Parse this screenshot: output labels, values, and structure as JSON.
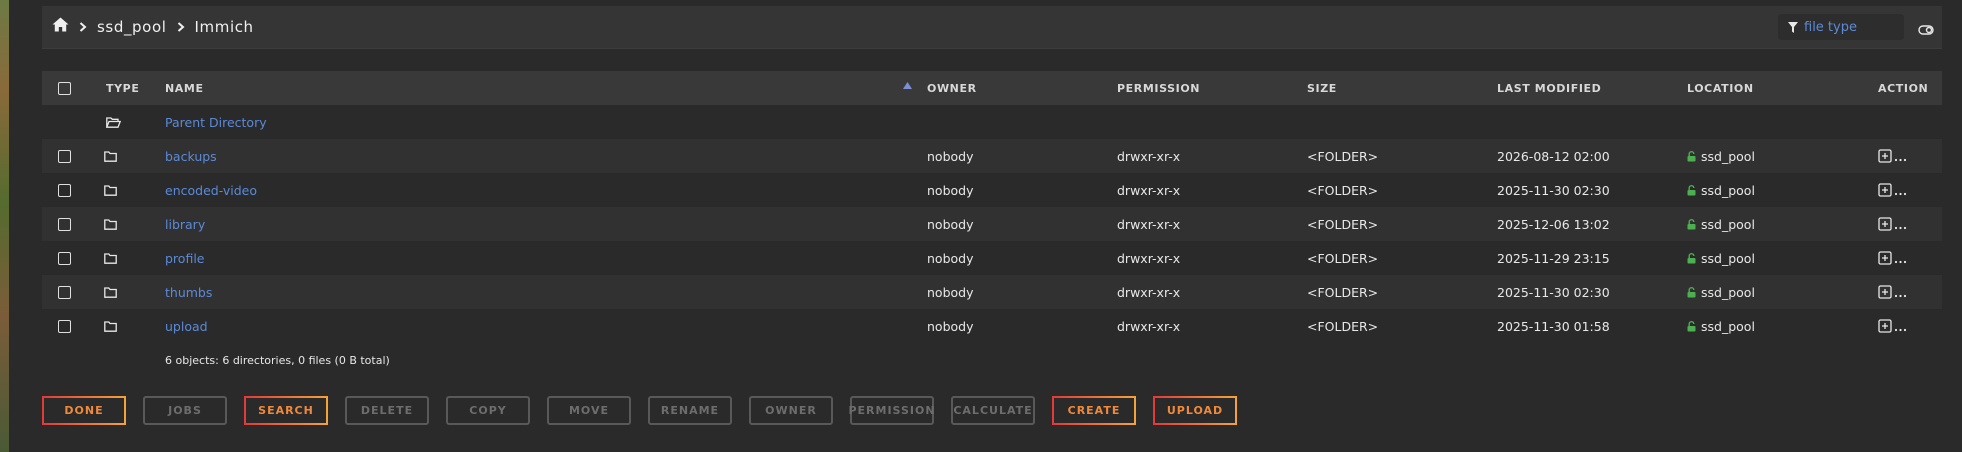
{
  "breadcrumb": {
    "items": [
      "ssd_pool",
      "Immich"
    ]
  },
  "filter": {
    "placeholder": "file type"
  },
  "columns": {
    "type": "TYPE",
    "name": "NAME",
    "owner": "OWNER",
    "permission": "PERMISSION",
    "size": "SIZE",
    "last_modified": "LAST MODIFIED",
    "location": "LOCATION",
    "action": "ACTION"
  },
  "parent_label": "Parent Directory",
  "rows": [
    {
      "name": "backups",
      "owner": "nobody",
      "permission": "drwxr-xr-x",
      "size": "<FOLDER>",
      "modified": "2026-08-12 02:00",
      "location": "ssd_pool"
    },
    {
      "name": "encoded-video",
      "owner": "nobody",
      "permission": "drwxr-xr-x",
      "size": "<FOLDER>",
      "modified": "2025-11-30 02:30",
      "location": "ssd_pool"
    },
    {
      "name": "library",
      "owner": "nobody",
      "permission": "drwxr-xr-x",
      "size": "<FOLDER>",
      "modified": "2025-12-06 13:02",
      "location": "ssd_pool"
    },
    {
      "name": "profile",
      "owner": "nobody",
      "permission": "drwxr-xr-x",
      "size": "<FOLDER>",
      "modified": "2025-11-29 23:15",
      "location": "ssd_pool"
    },
    {
      "name": "thumbs",
      "owner": "nobody",
      "permission": "drwxr-xr-x",
      "size": "<FOLDER>",
      "modified": "2025-11-30 02:30",
      "location": "ssd_pool"
    },
    {
      "name": "upload",
      "owner": "nobody",
      "permission": "drwxr-xr-x",
      "size": "<FOLDER>",
      "modified": "2025-11-30 01:58",
      "location": "ssd_pool"
    }
  ],
  "summary": "6 objects: 6 directories, 0 files (0 B total)",
  "buttons": {
    "done": "DONE",
    "jobs": "JOBS",
    "search": "SEARCH",
    "delete": "DELETE",
    "copy": "COPY",
    "move": "MOVE",
    "rename": "RENAME",
    "owner": "OWNER",
    "permission": "PERMISSION",
    "calculate": "CALCULATE",
    "create": "CREATE",
    "upload": "UPLOAD"
  },
  "colors": {
    "accent_link": "#5b8ad6",
    "lock_green": "#4caf50",
    "button_active": "#f08a3a",
    "background": "#2b2a2b"
  },
  "icons": {
    "home": "home-icon",
    "chevron": "chevron-right-icon",
    "filter": "filter-icon",
    "folder": "folder-icon",
    "folder_open": "folder-open-icon",
    "lock": "unlock-icon",
    "action": "action-menu-icon",
    "sort": "sort-up-icon"
  }
}
